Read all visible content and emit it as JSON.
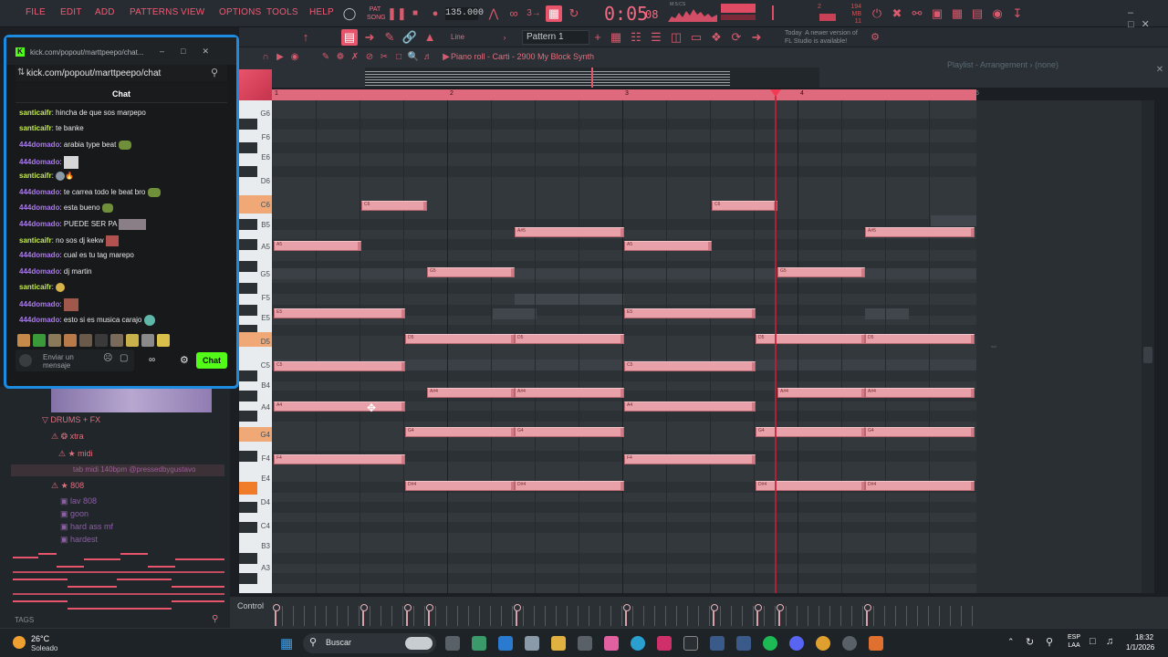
{
  "menu": [
    "FILE",
    "EDIT",
    "ADD",
    "PATTERNS",
    "VIEW",
    "OPTIONS",
    "TOOLS",
    "HELP"
  ],
  "transport": {
    "tempo": "135.000",
    "time_main": "0:05",
    "time_sub": "08",
    "mode_label": "PAT",
    "song_label": "SONG",
    "cpu_mem": "194 MB",
    "cpu_num": "11",
    "ticks_label": "M:S:CS"
  },
  "toolbar2": {
    "line_label": "Line",
    "pattern_label": "Pattern 1",
    "news": "Today  A newer version of\nFL Studio is available!"
  },
  "piano_roll": {
    "title": "Piano roll - Carti - 2900 My Block Synth",
    "playlist_tab": "Playlist - Arrangement › (none)",
    "bars": [
      "1",
      "2",
      "3",
      "4",
      "5"
    ]
  },
  "keyboard": {
    "labels": [
      "G6",
      "F6",
      "E6",
      "D6",
      "C6",
      "B5",
      "A5",
      "G5",
      "F5",
      "E5",
      "D5",
      "C5",
      "B4",
      "A4",
      "G4",
      "F4",
      "E4",
      "D4",
      "C4",
      "B3",
      "A3"
    ]
  },
  "notes": [
    {
      "label": "A5"
    },
    {
      "label": "C6"
    },
    {
      "label": "G5"
    },
    {
      "label": "A#5"
    },
    {
      "label": "A5"
    },
    {
      "label": "C6"
    },
    {
      "label": "G5"
    },
    {
      "label": "A#5"
    },
    {
      "label": "E5"
    },
    {
      "label": "D5"
    },
    {
      "label": "D5"
    },
    {
      "label": "E5"
    },
    {
      "label": "D5"
    },
    {
      "label": "D5"
    },
    {
      "label": "C5"
    },
    {
      "label": "C5"
    },
    {
      "label": "A#4"
    },
    {
      "label": "A#4"
    },
    {
      "label": "A#4"
    },
    {
      "label": "A#4"
    },
    {
      "label": "A4"
    },
    {
      "label": "A4"
    },
    {
      "label": "G4"
    },
    {
      "label": "G4"
    },
    {
      "label": "G4"
    },
    {
      "label": "G4"
    },
    {
      "label": "F4"
    },
    {
      "label": "F4"
    },
    {
      "label": "D#4"
    },
    {
      "label": "D#4"
    },
    {
      "label": "D#4"
    },
    {
      "label": "D#4"
    }
  ],
  "control": {
    "label": "Control"
  },
  "browser": {
    "items": [
      {
        "label": "DRUMS + FX",
        "color": "#e0707f"
      },
      {
        "label": "xtra",
        "color": "#e0707f"
      },
      {
        "label": "midi",
        "color": "#e0707f"
      },
      {
        "label": "tab midi 140bpm @pressedbygustavo",
        "color": "#9d5f96"
      },
      {
        "label": "808",
        "color": "#e0707f"
      },
      {
        "label": "lav 808",
        "color": "#8d5fa6"
      },
      {
        "label": "goon",
        "color": "#8d5fa6"
      },
      {
        "label": "hard ass mf",
        "color": "#8d5fa6"
      },
      {
        "label": "hardest",
        "color": "#8d5fa6"
      }
    ],
    "tags_label": "TAGS"
  },
  "chat": {
    "window_title": "kick.com/popout/marttpeepo/chat...",
    "url": "kick.com/popout/marttpeepo/chat",
    "header": "Chat",
    "messages": [
      {
        "user": "santicaifr",
        "text": "hincha de que sos marpepo",
        "color": "#c5e85a"
      },
      {
        "user": "santicaifr",
        "text": "te banke",
        "color": "#c5e85a"
      },
      {
        "user": "444domado",
        "text": "arabia type beat",
        "color": "#a97be8"
      },
      {
        "user": "444domado",
        "text": "",
        "color": "#a97be8"
      },
      {
        "user": "santicaifr",
        "text": "",
        "color": "#c5e85a"
      },
      {
        "user": "444domado",
        "text": "te carrea todo le beat bro",
        "color": "#a97be8"
      },
      {
        "user": "444domado",
        "text": "esta bueno",
        "color": "#a97be8"
      },
      {
        "user": "444domado",
        "text": "PUEDE SER PA",
        "color": "#a97be8"
      },
      {
        "user": "santicaifr",
        "text": "no sos dj kekw",
        "color": "#c5e85a"
      },
      {
        "user": "444domado",
        "text": "cual es tu tag marepo",
        "color": "#a97be8"
      },
      {
        "user": "444domado",
        "text": "dj martin",
        "color": "#a97be8"
      },
      {
        "user": "santicaifr",
        "text": "",
        "color": "#c5e85a"
      },
      {
        "user": "444domado",
        "text": "",
        "color": "#a97be8"
      },
      {
        "user": "444domado",
        "text": "esto si es musica carajo",
        "color": "#a97be8"
      }
    ],
    "input_placeholder": "Enviar un mensaje",
    "send_label": "Chat"
  },
  "taskbar": {
    "weather_temp": "26°C",
    "weather_desc": "Soleado",
    "search": "Buscar",
    "lang": "ESP\nLAA",
    "time": "18:32",
    "date": "1/1/2026"
  },
  "colors": {
    "accent": "#f05a74",
    "note": "#e8a1a8",
    "playhead": "#c51d35",
    "kick_green": "#53fc18"
  }
}
